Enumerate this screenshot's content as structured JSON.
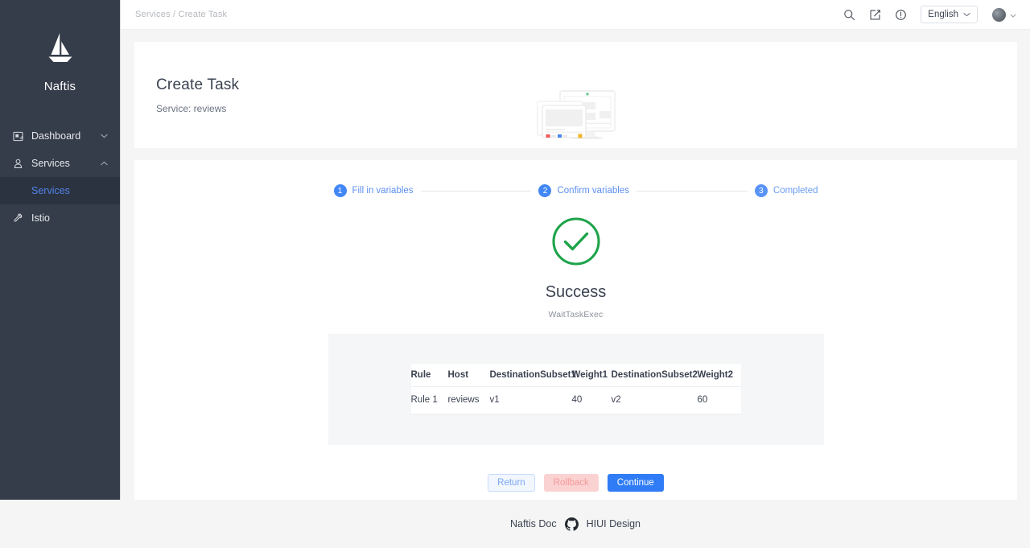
{
  "sidebar": {
    "brand": {
      "name": "Naftis",
      "logo_icon": "sailboat-icon"
    },
    "items": [
      {
        "label": "Dashboard",
        "icon": "dashboard-icon",
        "caret": "chevron-down-icon"
      },
      {
        "label": "Services",
        "icon": "services-icon",
        "caret": "chevron-up-icon"
      },
      {
        "label": "Istio",
        "icon": "istio-wrench-icon",
        "caret": ""
      }
    ],
    "sub_item": {
      "label": "Services",
      "active_color": "#4f82e8"
    },
    "bg_color": "#353d4a",
    "active_bg_color": "#2c3340"
  },
  "topbar": {
    "breadcrumb": "Services / Create Task",
    "icons": [
      {
        "name": "search-icon"
      },
      {
        "name": "compose-icon"
      },
      {
        "name": "info-icon"
      }
    ],
    "language": {
      "value": "English",
      "caret": "chevron-down-icon"
    },
    "avatar": {
      "name": "user-avatar",
      "caret": "caret-down-icon"
    }
  },
  "header": {
    "title": "Create Task",
    "subtitle": "Service: reviews",
    "illustration": "monitor-windows-illustration"
  },
  "stepper": {
    "steps": [
      {
        "num": "1",
        "label": "Fill in variables"
      },
      {
        "num": "2",
        "label": "Confirm variables"
      },
      {
        "num": "3",
        "label": "Completed"
      }
    ],
    "active_color": "#4287f5"
  },
  "result": {
    "status_icon": "success-check-icon",
    "status_color": "#1ea34a",
    "title": "Success",
    "subtitle": "WaitTaskExec"
  },
  "table": {
    "columns": [
      "Rule",
      "Host",
      "DestinationSubset1",
      "Weight1",
      "DestinationSubset2",
      "Weight2"
    ],
    "rows": [
      {
        "rule": "Rule 1",
        "host": "reviews",
        "destination_subset_1": "v1",
        "weight_1": "40",
        "destination_subset_2": "v2",
        "weight_2": "60"
      }
    ]
  },
  "buttons": {
    "return": "Return",
    "rollback": "Rollback",
    "continue": "Continue",
    "continue_color": "#2f7cf6",
    "rollback_color": "#fbd2d2"
  },
  "footer": {
    "doc_link": "Naftis Doc",
    "github_icon": "github-icon",
    "design_link": "HIUI Design"
  }
}
